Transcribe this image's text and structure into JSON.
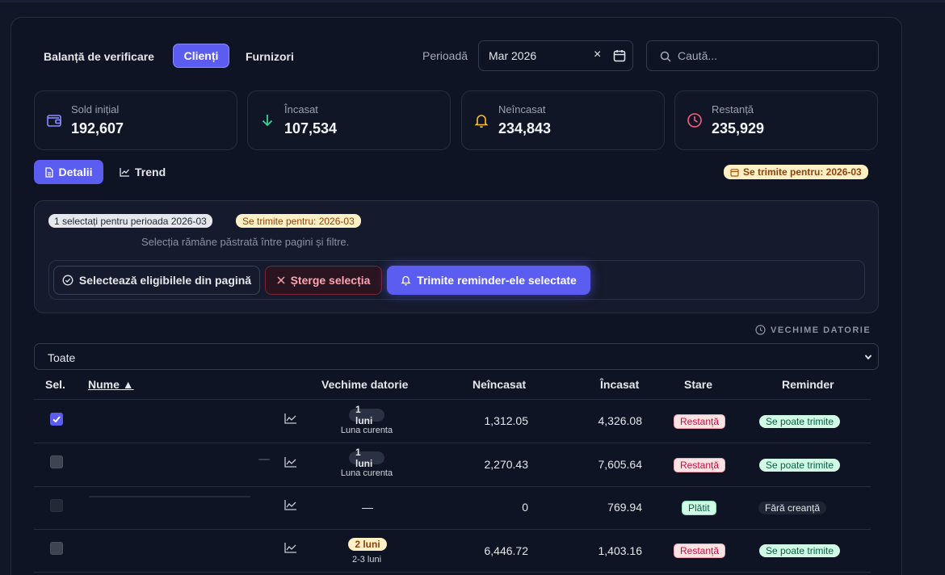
{
  "tabs": [
    {
      "label": "Balanță de verificare",
      "active": false
    },
    {
      "label": "Clienți",
      "active": true
    },
    {
      "label": "Furnizori",
      "active": false
    }
  ],
  "filter": {
    "period_label": "Perioadă",
    "period_value": "Mar 2026",
    "clear_icon": "×",
    "search_placeholder": "Caută..."
  },
  "stats": [
    {
      "label": "Sold inițial",
      "value": "192,607",
      "icon": "wallet-icon",
      "color": "#8b8cff"
    },
    {
      "label": "Încasat",
      "value": "107,534",
      "icon": "arrow-down-icon",
      "color": "#34d399"
    },
    {
      "label": "Neîncasat",
      "value": "234,843",
      "icon": "bell-icon",
      "color": "#fbbf24"
    },
    {
      "label": "Restanță",
      "value": "235,929",
      "icon": "clock-icon",
      "color": "#fb5d7c"
    }
  ],
  "view": {
    "details_label": "Detalii",
    "trend_label": "Trend",
    "send_for_badge": "Se trimite pentru: 2026-03"
  },
  "selection": {
    "count_badge": "1 selectați pentru perioada 2026-03",
    "send_for_badge": "Se trimite pentru: 2026-03",
    "note": "Selecția rămâne păstrată între pagini și filtre.",
    "select_eligible_label": "Selectează eligibilele din pagină",
    "clear_label": "Șterge selecția",
    "send_label": "Trimite reminder-ele selectate"
  },
  "debt_age": {
    "section_label": "VECHIME DATORIE",
    "filter_value": "Toate"
  },
  "table": {
    "headers": {
      "sel": "Sel.",
      "name": "Nume ▲",
      "age": "Vechime datorie",
      "unpaid": "Neîncasat",
      "paid": "Încasat",
      "status": "Stare",
      "reminder": "Reminder"
    },
    "rows": [
      {
        "selected": true,
        "age": "1 luni",
        "age_sub": "Luna curenta",
        "age_warn": false,
        "unpaid": "1,312.05",
        "paid": "4,326.08",
        "status": "Restanță",
        "status_kind": "red",
        "reminder": "Se poate trimite",
        "reminder_kind": "ok"
      },
      {
        "selected": false,
        "age": "1 luni",
        "age_sub": "Luna curenta",
        "age_warn": false,
        "unpaid": "2,270.43",
        "paid": "7,605.64",
        "status": "Restanță",
        "status_kind": "red",
        "reminder": "Se poate trimite",
        "reminder_kind": "ok"
      },
      {
        "selected": false,
        "age": "—",
        "age_sub": "",
        "age_warn": false,
        "unpaid": "0",
        "paid": "769.94",
        "status": "Plătit",
        "status_kind": "green",
        "reminder": "Fără creanță",
        "reminder_kind": "none"
      },
      {
        "selected": false,
        "age": "2 luni",
        "age_sub": "2-3 luni",
        "age_warn": true,
        "unpaid": "6,446.72",
        "paid": "1,403.16",
        "status": "Restanță",
        "status_kind": "red",
        "reminder": "Se poate trimite",
        "reminder_kind": "ok"
      }
    ]
  }
}
